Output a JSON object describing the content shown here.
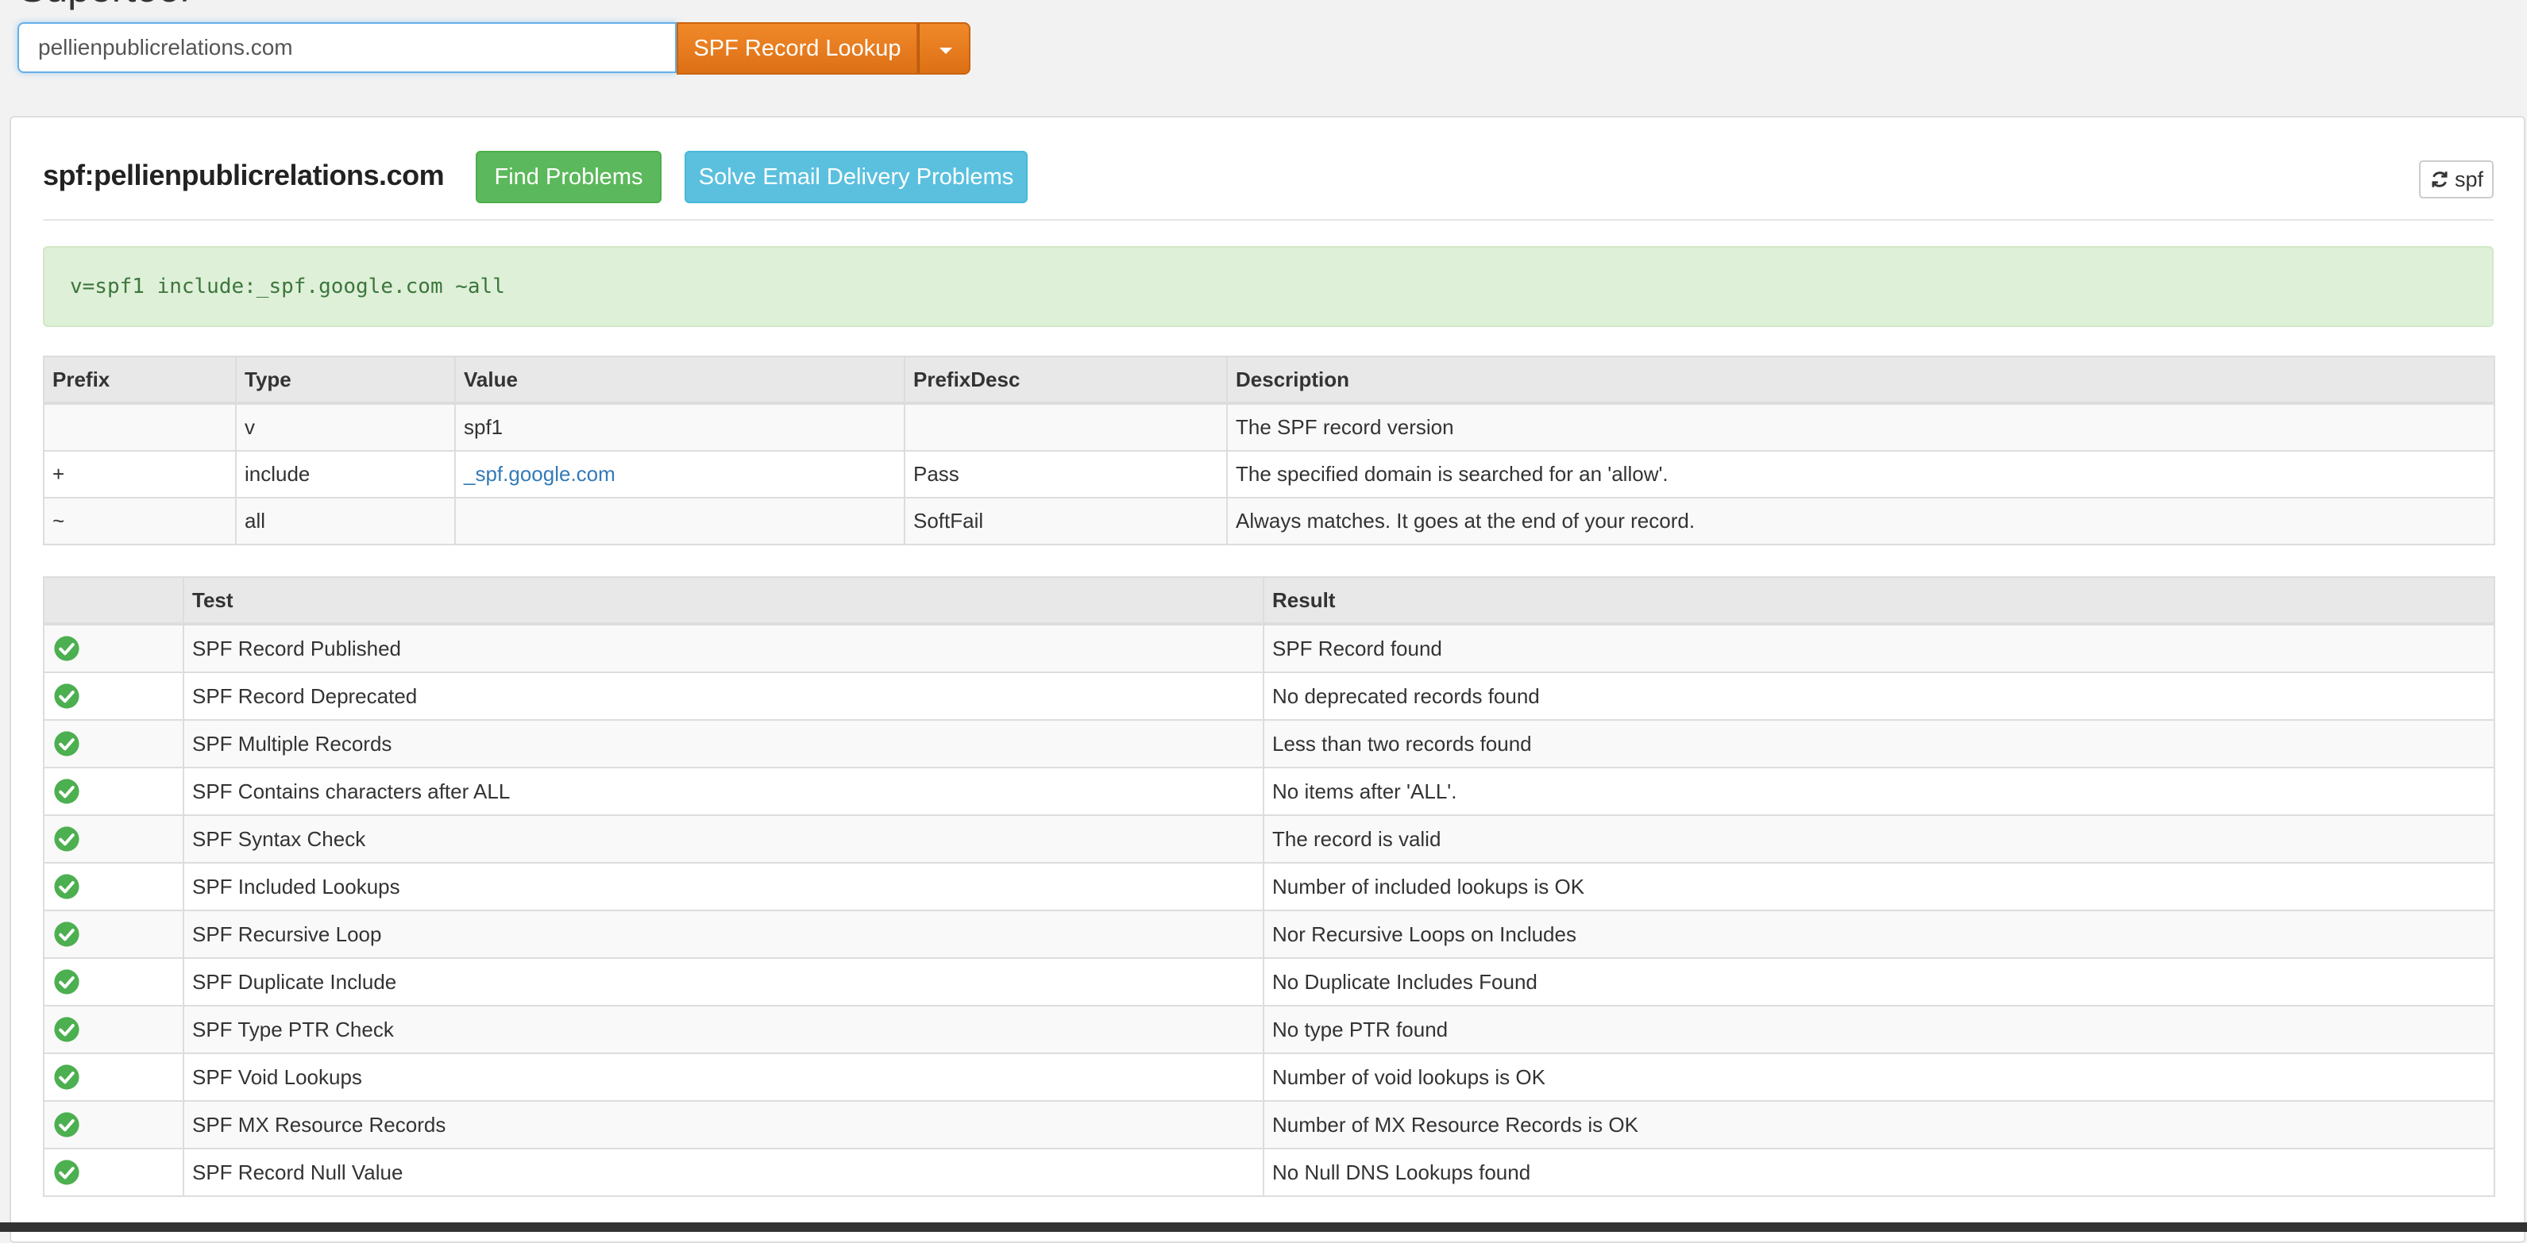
{
  "header": {
    "title_cut": "Supertool",
    "search_value": "pellienpublicrelations.com",
    "lookup_label": "SPF Record Lookup"
  },
  "panel": {
    "title": "spf:pellienpublicrelations.com",
    "find_problems_label": "Find Problems",
    "solve_label": "Solve Email Delivery Problems",
    "refresh_label": "spf",
    "record": "v=spf1 include:_spf.google.com ~all"
  },
  "parse_table": {
    "headers": [
      "Prefix",
      "Type",
      "Value",
      "PrefixDesc",
      "Description"
    ],
    "rows": [
      {
        "prefix": "",
        "type": "v",
        "value": "spf1",
        "prefix_desc": "",
        "description": "The SPF record version"
      },
      {
        "prefix": "+",
        "type": "include",
        "value": "_spf.google.com",
        "prefix_desc": "Pass",
        "description": "The specified domain is searched for an 'allow'."
      },
      {
        "prefix": "~",
        "type": "all",
        "value": "",
        "prefix_desc": "SoftFail",
        "description": "Always matches. It goes at the end of your record."
      }
    ]
  },
  "test_table": {
    "headers": [
      "",
      "Test",
      "Result"
    ],
    "rows": [
      {
        "status": "check-icon",
        "test": "SPF Record Published",
        "result": "SPF Record found"
      },
      {
        "status": "check-icon",
        "test": "SPF Record Deprecated",
        "result": "No deprecated records found"
      },
      {
        "status": "check-icon",
        "test": "SPF Multiple Records",
        "result": "Less than two records found"
      },
      {
        "status": "check-icon",
        "test": "SPF Contains characters after ALL",
        "result": "No items after 'ALL'."
      },
      {
        "status": "check-icon",
        "test": "SPF Syntax Check",
        "result": "The record is valid"
      },
      {
        "status": "check-icon",
        "test": "SPF Included Lookups",
        "result": "Number of included lookups is OK"
      },
      {
        "status": "check-icon",
        "test": "SPF Recursive Loop",
        "result": "Nor Recursive Loops on Includes"
      },
      {
        "status": "check-icon",
        "test": "SPF Duplicate Include",
        "result": "No Duplicate Includes Found"
      },
      {
        "status": "check-icon",
        "test": "SPF Type PTR Check",
        "result": "No type PTR found"
      },
      {
        "status": "check-icon",
        "test": "SPF Void Lookups",
        "result": "Number of void lookups is OK"
      },
      {
        "status": "check-icon",
        "test": "SPF MX Resource Records",
        "result": "Number of MX Resource Records is OK"
      },
      {
        "status": "check-icon",
        "test": "SPF Record Null Value",
        "result": "No Null DNS Lookups found"
      }
    ]
  },
  "colors": {
    "lookup_orange": "#e67e22",
    "success_green": "#5cb85c",
    "info_blue": "#5bc0de",
    "record_bg": "#dff0d8",
    "record_text": "#3c763d",
    "link": "#337ab7",
    "check": "#4caf50"
  }
}
